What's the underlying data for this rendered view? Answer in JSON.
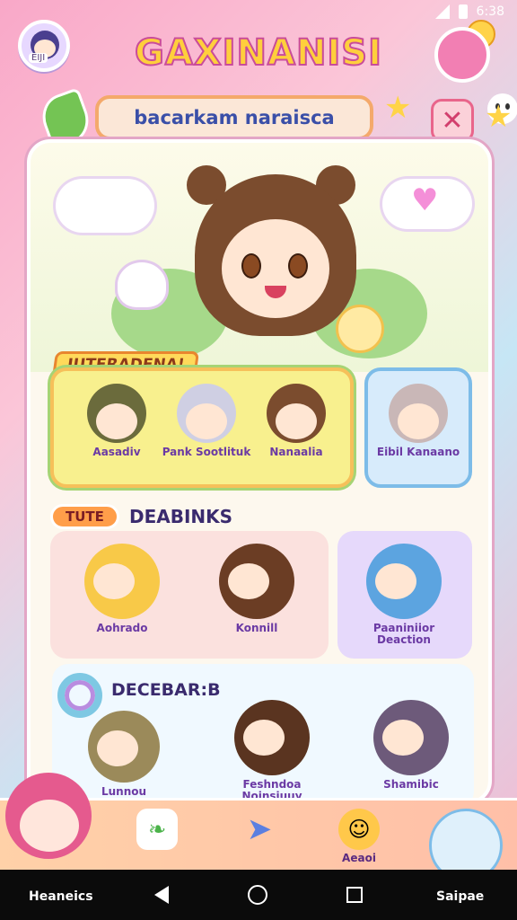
{
  "status_bar": {
    "time": "6:38"
  },
  "header": {
    "app_title": "GAXINANISI",
    "profile_badge": "EIJI",
    "search_text": "bacarkam naraisca",
    "close_symbol": "✕"
  },
  "sections": {
    "featured_tag": "IUTFRADENA!",
    "group_card": {
      "characters": [
        {
          "name": "Aasadiv",
          "hair": "#6b6b3c"
        },
        {
          "name": "Pank Sootlituk",
          "hair": "#cfcfe3"
        },
        {
          "name": "Nanaalia",
          "hair": "#7b4c2e"
        }
      ]
    },
    "single_card": {
      "name": "Eibil Kanaano",
      "hair": "#c9b7b7"
    },
    "row2": {
      "tag": "TUTE",
      "title": "DEABINKS",
      "characters": [
        {
          "name": "Aohrado",
          "hair": "#f8c948"
        },
        {
          "name": "Konnill",
          "hair": "#6b3d24"
        },
        {
          "name": "Paaniniior Deaction",
          "hair": "#5ca4e0"
        }
      ]
    },
    "row3": {
      "title": "DECEBAR:B",
      "characters": [
        {
          "name": "Lunnou",
          "hair": "#9b8a5a"
        },
        {
          "name": "Feshndoa Noinsiuuy",
          "hair": "#5a3420"
        },
        {
          "name": "Shamibic",
          "hair": "#6d5a7a"
        }
      ]
    }
  },
  "bottom_nav": {
    "left_name": "Heaneics",
    "right_name": "Saipae",
    "items": [
      {
        "icon": "leaf-icon",
        "label": ""
      },
      {
        "icon": "paper-plane-icon",
        "label": ""
      },
      {
        "icon": "smiley-icon",
        "label": "Aeaoi"
      }
    ]
  },
  "colors": {
    "accent": "#f27fb3",
    "title_fill": "#ffcf3c",
    "title_stroke": "#c94c9a"
  }
}
